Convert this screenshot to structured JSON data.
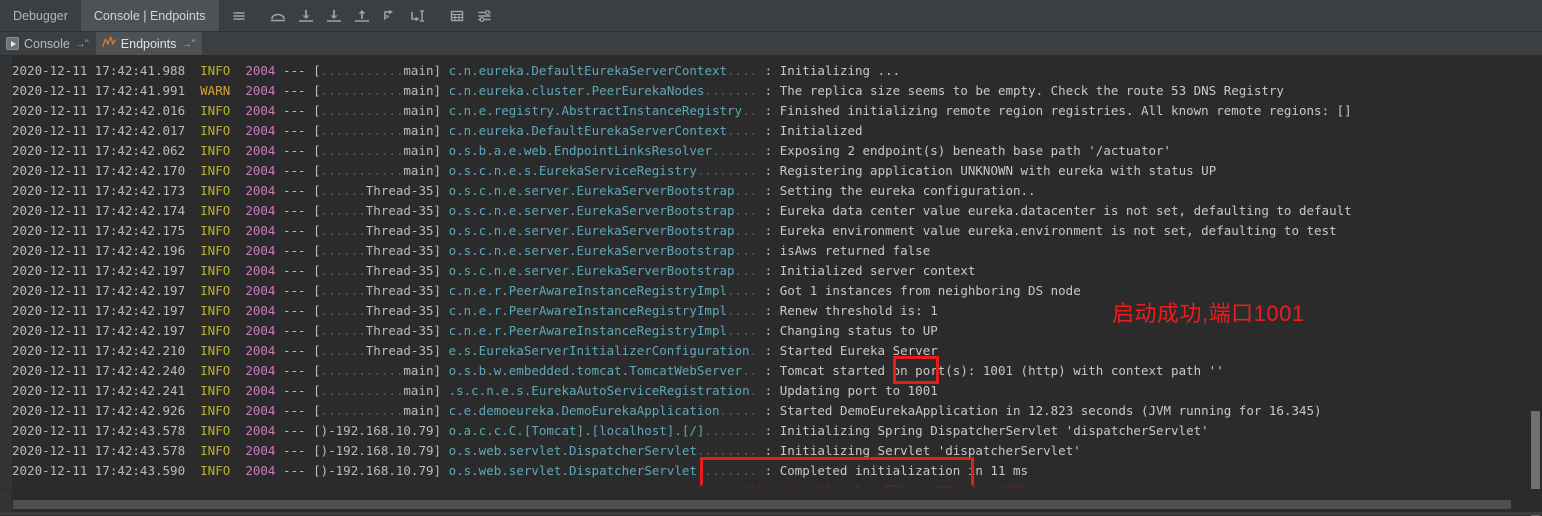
{
  "window": {
    "accent_color": "#4b6eaf",
    "background": "#2b2b2b",
    "toolbar_background": "#3c3f41"
  },
  "toolbar": {
    "tabs": [
      {
        "label": "Debugger",
        "active": false
      },
      {
        "label": "Console | Endpoints",
        "active": true
      }
    ],
    "buttons": [
      {
        "name": "menu-icon",
        "title": "Menu"
      },
      {
        "name": "step-over-icon",
        "title": "Step Over"
      },
      {
        "name": "step-into-icon",
        "title": "Step Into"
      },
      {
        "name": "force-step-into-icon",
        "title": "Force Step Into"
      },
      {
        "name": "step-out-icon",
        "title": "Step Out"
      },
      {
        "name": "drop-frame-icon",
        "title": "Drop Frame"
      },
      {
        "name": "run-to-cursor-icon",
        "title": "Run to Cursor"
      },
      {
        "name": "evaluate-expression-icon",
        "title": "Evaluate Expression"
      },
      {
        "name": "settings-icon",
        "title": "Settings"
      }
    ]
  },
  "subtabs": [
    {
      "label": "Console",
      "pin": "→\"",
      "icon": "run-icon",
      "active": false
    },
    {
      "label": "Endpoints",
      "pin": "→\"",
      "icon": "endpoints-graph-icon",
      "active": true
    }
  ],
  "console": {
    "colors": {
      "timestamp": "#bbbbbb",
      "info": "#bbb529",
      "warn": "#d6a13b",
      "pid": "#c77dbb",
      "logger": "#5fa8b8",
      "message": "#c8c8c8"
    },
    "log_lines": [
      {
        "ts": "2020-12-11 17:42:41.988",
        "level": "INFO",
        "pid": "2004",
        "thread": "main",
        "logger": "c.n.eureka.DefaultEurekaServerContext",
        "message": "Initializing ..."
      },
      {
        "ts": "2020-12-11 17:42:41.991",
        "level": "WARN",
        "pid": "2004",
        "thread": "main",
        "logger": "c.n.eureka.cluster.PeerEurekaNodes",
        "message": "The replica size seems to be empty. Check the route 53 DNS Registry"
      },
      {
        "ts": "2020-12-11 17:42:42.016",
        "level": "INFO",
        "pid": "2004",
        "thread": "main",
        "logger": "c.n.e.registry.AbstractInstanceRegistry",
        "message": "Finished initializing remote region registries. All known remote regions: []"
      },
      {
        "ts": "2020-12-11 17:42:42.017",
        "level": "INFO",
        "pid": "2004",
        "thread": "main",
        "logger": "c.n.eureka.DefaultEurekaServerContext",
        "message": "Initialized"
      },
      {
        "ts": "2020-12-11 17:42:42.062",
        "level": "INFO",
        "pid": "2004",
        "thread": "main",
        "logger": "o.s.b.a.e.web.EndpointLinksResolver",
        "message": "Exposing 2 endpoint(s) beneath base path '/actuator'"
      },
      {
        "ts": "2020-12-11 17:42:42.170",
        "level": "INFO",
        "pid": "2004",
        "thread": "main",
        "logger": "o.s.c.n.e.s.EurekaServiceRegistry",
        "message": "Registering application UNKNOWN with eureka with status UP"
      },
      {
        "ts": "2020-12-11 17:42:42.173",
        "level": "INFO",
        "pid": "2004",
        "thread": "Thread-35",
        "logger": "o.s.c.n.e.server.EurekaServerBootstrap",
        "message": "Setting the eureka configuration.."
      },
      {
        "ts": "2020-12-11 17:42:42.174",
        "level": "INFO",
        "pid": "2004",
        "thread": "Thread-35",
        "logger": "o.s.c.n.e.server.EurekaServerBootstrap",
        "message": "Eureka data center value eureka.datacenter is not set, defaulting to default"
      },
      {
        "ts": "2020-12-11 17:42:42.175",
        "level": "INFO",
        "pid": "2004",
        "thread": "Thread-35",
        "logger": "o.s.c.n.e.server.EurekaServerBootstrap",
        "message": "Eureka environment value eureka.environment is not set, defaulting to test"
      },
      {
        "ts": "2020-12-11 17:42:42.196",
        "level": "INFO",
        "pid": "2004",
        "thread": "Thread-35",
        "logger": "o.s.c.n.e.server.EurekaServerBootstrap",
        "message": "isAws returned false"
      },
      {
        "ts": "2020-12-11 17:42:42.197",
        "level": "INFO",
        "pid": "2004",
        "thread": "Thread-35",
        "logger": "o.s.c.n.e.server.EurekaServerBootstrap",
        "message": "Initialized server context"
      },
      {
        "ts": "2020-12-11 17:42:42.197",
        "level": "INFO",
        "pid": "2004",
        "thread": "Thread-35",
        "logger": "c.n.e.r.PeerAwareInstanceRegistryImpl",
        "message": "Got 1 instances from neighboring DS node"
      },
      {
        "ts": "2020-12-11 17:42:42.197",
        "level": "INFO",
        "pid": "2004",
        "thread": "Thread-35",
        "logger": "c.n.e.r.PeerAwareInstanceRegistryImpl",
        "message": "Renew threshold is: 1"
      },
      {
        "ts": "2020-12-11 17:42:42.197",
        "level": "INFO",
        "pid": "2004",
        "thread": "Thread-35",
        "logger": "c.n.e.r.PeerAwareInstanceRegistryImpl",
        "message": "Changing status to UP"
      },
      {
        "ts": "2020-12-11 17:42:42.210",
        "level": "INFO",
        "pid": "2004",
        "thread": "Thread-35",
        "logger": "e.s.EurekaServerInitializerConfiguration",
        "message": "Started Eureka Server"
      },
      {
        "ts": "2020-12-11 17:42:42.240",
        "level": "INFO",
        "pid": "2004",
        "thread": "main",
        "logger": "o.s.b.w.embedded.tomcat.TomcatWebServer",
        "message": "Tomcat started on port(s): 1001 (http) with context path ''"
      },
      {
        "ts": "2020-12-11 17:42:42.241",
        "level": "INFO",
        "pid": "2004",
        "thread": "main",
        "logger": ".s.c.n.e.s.EurekaAutoServiceRegistration",
        "message": "Updating port to 1001"
      },
      {
        "ts": "2020-12-11 17:42:42.926",
        "level": "INFO",
        "pid": "2004",
        "thread": "main",
        "logger": "c.e.demoeureka.DemoEurekaApplication",
        "message": "Started DemoEurekaApplication in 12.823 seconds (JVM running for 16.345)"
      },
      {
        "ts": "2020-12-11 17:42:43.578",
        "level": "INFO",
        "pid": "2004",
        "thread": ")-192.168.10.79",
        "logger": "o.a.c.c.C.[Tomcat].[localhost].[/]",
        "message": "Initializing Spring DispatcherServlet 'dispatcherServlet'"
      },
      {
        "ts": "2020-12-11 17:42:43.578",
        "level": "INFO",
        "pid": "2004",
        "thread": ")-192.168.10.79",
        "logger": "o.s.web.servlet.DispatcherServlet",
        "message": "Initializing Servlet 'dispatcherServlet'"
      },
      {
        "ts": "2020-12-11 17:42:43.590",
        "level": "INFO",
        "pid": "2004",
        "thread": ")-192.168.10.79",
        "logger": "o.s.web.servlet.DispatcherServlet",
        "message": "Completed initialization in 11 ms"
      }
    ]
  },
  "annotations": {
    "color": "#ee1d1d",
    "note_text": "启动成功,端口1001",
    "highlight_port_value": "1001",
    "highlight_completed_text": "Completed initialization in 11 ms"
  },
  "watermark": {
    "text": "微信公众号:三分恶"
  }
}
